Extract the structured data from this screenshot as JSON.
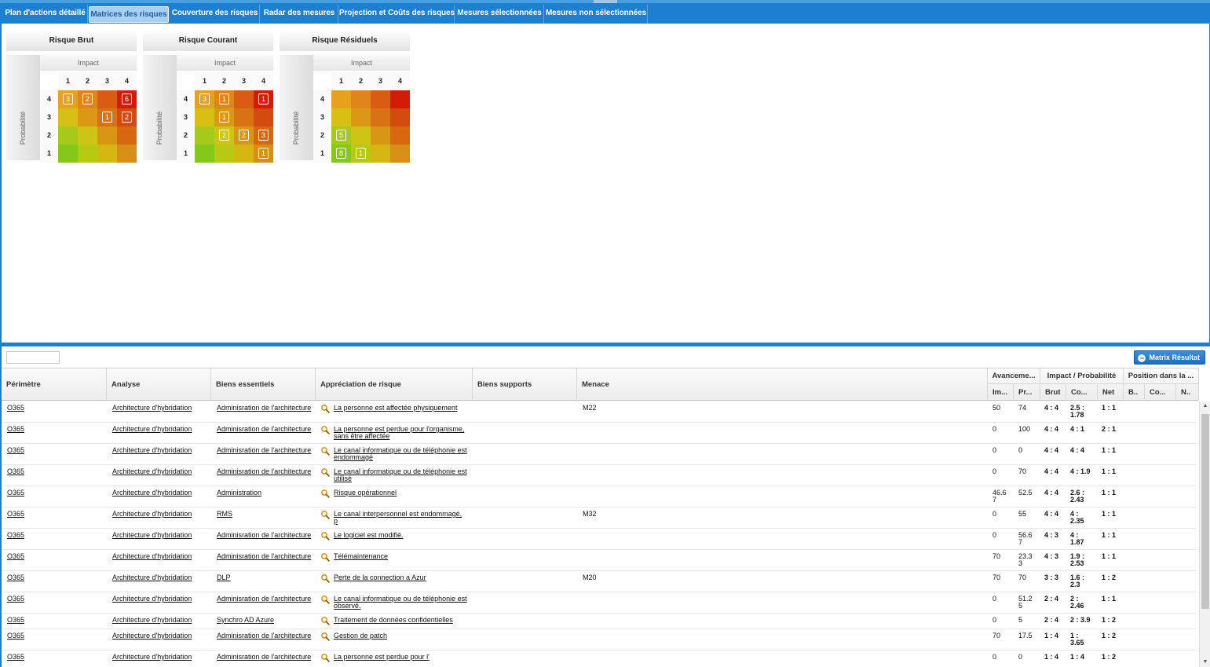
{
  "tabs": [
    {
      "label": "Plan d'actions détaillé",
      "active": false
    },
    {
      "label": "Matrices des risques",
      "active": true
    },
    {
      "label": "Couverture des risques",
      "active": false
    },
    {
      "label": "Radar des mesures",
      "active": false
    },
    {
      "label": "Projection et Coûts des risques",
      "active": false
    },
    {
      "label": "Mesures sélectionnées",
      "active": false
    },
    {
      "label": "Mesures non sélectionnées",
      "active": false
    }
  ],
  "matrices": [
    {
      "title": "Risque Brut",
      "impact_label": "Impact",
      "prob_label": "Probabilité",
      "columns": [
        "1",
        "2",
        "3",
        "4"
      ],
      "rows": [
        "4",
        "3",
        "2",
        "1"
      ],
      "colors": [
        [
          "#e7a11b",
          "#e1851a",
          "#da5c13",
          "#d31c06"
        ],
        [
          "#d7bf13",
          "#dc9715",
          "#d97214",
          "#d34b0f"
        ],
        [
          "#a4cb1b",
          "#cdc513",
          "#d99615",
          "#d8680f"
        ],
        [
          "#84c919",
          "#b8c913",
          "#d6b612",
          "#d88f15"
        ]
      ],
      "counts": [
        [
          "3",
          "2",
          "",
          "6"
        ],
        [
          "",
          "",
          "1",
          "2"
        ],
        [
          "",
          "",
          "",
          ""
        ],
        [
          "",
          "",
          "",
          ""
        ]
      ]
    },
    {
      "title": "Risque Courant",
      "impact_label": "Impact",
      "prob_label": "Probabilité",
      "columns": [
        "1",
        "2",
        "3",
        "4"
      ],
      "rows": [
        "4",
        "3",
        "2",
        "1"
      ],
      "colors": [
        [
          "#e7a11b",
          "#e1851a",
          "#da5c13",
          "#d31c06"
        ],
        [
          "#d7bf13",
          "#dc9715",
          "#d97214",
          "#d34b0f"
        ],
        [
          "#a4cb1b",
          "#cdc513",
          "#d99615",
          "#d8680f"
        ],
        [
          "#84c919",
          "#b8c913",
          "#d6b612",
          "#d88f15"
        ]
      ],
      "counts": [
        [
          "3",
          "1",
          "",
          "1"
        ],
        [
          "",
          "1",
          "",
          ""
        ],
        [
          "",
          "2",
          "2",
          "3"
        ],
        [
          "",
          "",
          "",
          "1"
        ]
      ]
    },
    {
      "title": "Risque Résiduels",
      "impact_label": "Impact",
      "prob_label": "Probabilité",
      "columns": [
        "1",
        "2",
        "3",
        "4"
      ],
      "rows": [
        "4",
        "3",
        "2",
        "1"
      ],
      "colors": [
        [
          "#e7a11b",
          "#e1851a",
          "#da5c13",
          "#d31c06"
        ],
        [
          "#d7bf13",
          "#dc9715",
          "#d97214",
          "#d34b0f"
        ],
        [
          "#a4cb1b",
          "#cdc513",
          "#d99615",
          "#d8680f"
        ],
        [
          "#84c919",
          "#b8c913",
          "#d6b612",
          "#d88f15"
        ]
      ],
      "counts": [
        [
          "",
          "",
          "",
          ""
        ],
        [
          "",
          "",
          "",
          ""
        ],
        [
          "5",
          "",
          "",
          ""
        ],
        [
          "8",
          "1",
          "",
          ""
        ]
      ]
    }
  ],
  "toolbar": {
    "filter_value": "",
    "matrix_button": "Matrix Résultat"
  },
  "grid": {
    "headers": {
      "perimetre": "Périmètre",
      "analyse": "Analyse",
      "biens_essentiels": "Biens essentiels",
      "appreciation": "Appréciation de risque",
      "biens_supports": "Biens supports",
      "menace": "Menace",
      "avancement": "Avanceme...",
      "avancement_im": "Im...",
      "avancement_pr": "Pr...",
      "impact_prob": "Impact / Probabilité",
      "ip_brut": "Brut",
      "ip_co": "Co...",
      "ip_net": "Net",
      "position": "Position dans la ...",
      "pos_b": "B..",
      "pos_co": "Co...",
      "pos_n": "N.."
    },
    "rows": [
      {
        "perimetre": "O365",
        "analyse": "Architecture d'hybridation",
        "bien": "Adminisration de l'architecture",
        "risque": "La personne est affectée physiquement",
        "menace": "M22",
        "im": "50",
        "pr": "74",
        "brut": "4 : 4",
        "co": "2.5 : 1.78",
        "net": "1 : 1"
      },
      {
        "perimetre": "O365",
        "analyse": "Architecture d'hybridation",
        "bien": "Adminisration de l'architecture",
        "risque": "La personne est perdue pour l'organisme, sans être affectée",
        "menace": "",
        "im": "0",
        "pr": "100",
        "brut": "4 : 4",
        "co": "4 : 1",
        "net": "2 : 1"
      },
      {
        "perimetre": "O365",
        "analyse": "Architecture d'hybridation",
        "bien": "Adminisration de l'architecture",
        "risque": "Le canal informatique ou de téléphonie est endommagé",
        "menace": "",
        "im": "0",
        "pr": "0",
        "brut": "4 : 4",
        "co": "4 : 4",
        "net": "1 : 1"
      },
      {
        "perimetre": "O365",
        "analyse": "Architecture d'hybridation",
        "bien": "Adminisration de l'architecture",
        "risque": "Le canal informatique ou de téléphonie est utilisé",
        "menace": "",
        "im": "0",
        "pr": "70",
        "brut": "4 : 4",
        "co": "4 : 1.9",
        "net": "1 : 1"
      },
      {
        "perimetre": "O365",
        "analyse": "Architecture d'hybridation",
        "bien": "Administration",
        "risque": "Risque opérationnel",
        "menace": "",
        "im": "46.6 7",
        "pr": "52.5",
        "brut": "4 : 4",
        "co": "2.6 : 2.43",
        "net": "1 : 1"
      },
      {
        "perimetre": "O365",
        "analyse": "Architecture d'hybridation",
        "bien": "RMS",
        "risque": "Le canal interpersonnel est endommagé, p",
        "menace": "M32",
        "im": "0",
        "pr": "55",
        "brut": "4 : 4",
        "co": "4 : 2.35",
        "net": "1 : 1"
      },
      {
        "perimetre": "O365",
        "analyse": "Architecture d'hybridation",
        "bien": "Adminisration de l'architecture",
        "risque": "Le logiciel est modifié.",
        "menace": "",
        "im": "0",
        "pr": "56.6 7",
        "brut": "4 : 3",
        "co": "4 : 1.87",
        "net": "1 : 1"
      },
      {
        "perimetre": "O365",
        "analyse": "Architecture d'hybridation",
        "bien": "Adminisration de l'architecture",
        "risque": "Télémaintenance",
        "menace": "",
        "im": "70",
        "pr": "23.3 3",
        "brut": "4 : 3",
        "co": "1.9 : 2.53",
        "net": "1 : 1"
      },
      {
        "perimetre": "O365",
        "analyse": "Architecture d'hybridation",
        "bien": "DLP",
        "risque": "Perte de la connection a Azur",
        "menace": "M20",
        "im": "70",
        "pr": "70",
        "brut": "3 : 3",
        "co": "1.6 : 2.3",
        "net": "1 : 2"
      },
      {
        "perimetre": "O365",
        "analyse": "Architecture d'hybridation",
        "bien": "Adminisration de l'architecture",
        "risque": "Le canal informatique ou de téléphonie est observé.",
        "menace": "",
        "im": "0",
        "pr": "51.2 5",
        "brut": "2 : 4",
        "co": "2 : 2.46",
        "net": "1 : 1"
      },
      {
        "perimetre": "O365",
        "analyse": "Architecture d'hybridation",
        "bien": "Synchro AD Azure",
        "risque": "Traitement de données confidentielles",
        "menace": "",
        "im": "0",
        "pr": "5",
        "brut": "2 : 4",
        "co": "2 : 3.9",
        "net": "1 : 2"
      },
      {
        "perimetre": "O365",
        "analyse": "Architecture d'hybridation",
        "bien": "Adminisration de l'architecture",
        "risque": "Gestion de patch",
        "menace": "",
        "im": "70",
        "pr": "17.5",
        "brut": "1 : 4",
        "co": "1 : 3.65",
        "net": "1 : 2"
      },
      {
        "perimetre": "O365",
        "analyse": "Architecture d'hybridation",
        "bien": "Adminisration de l'architecture",
        "risque": "La personne est perdue pour l'",
        "menace": "",
        "im": "0",
        "pr": "0",
        "brut": "1 : 4",
        "co": "1 : 4",
        "net": "1 : 2"
      }
    ]
  },
  "icons": {
    "appreciation_icon": "magnifier-icon",
    "matrix_button_icon": "circle-icon",
    "scroll_up": "▲",
    "scroll_down": "▼"
  }
}
